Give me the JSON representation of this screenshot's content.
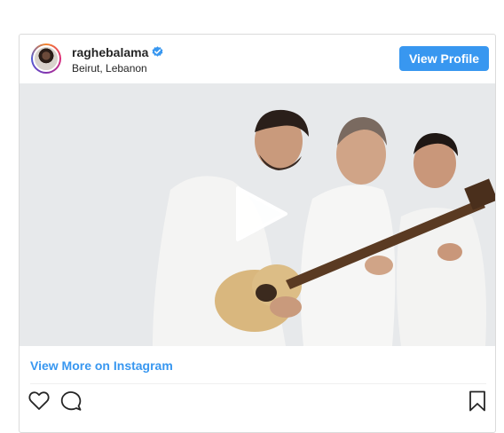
{
  "post": {
    "username": "raghebalama",
    "location": "Beirut, Lebanon",
    "view_profile_label": "View Profile",
    "view_more_label": "View More on Instagram",
    "verified": true
  },
  "colors": {
    "accent": "#3897f0",
    "text": "#262626",
    "border": "#dbdbdb"
  },
  "icons": {
    "verified": "verified-badge-icon",
    "play": "play-icon",
    "like": "heart-icon",
    "comment": "comment-icon",
    "save": "bookmark-icon"
  }
}
